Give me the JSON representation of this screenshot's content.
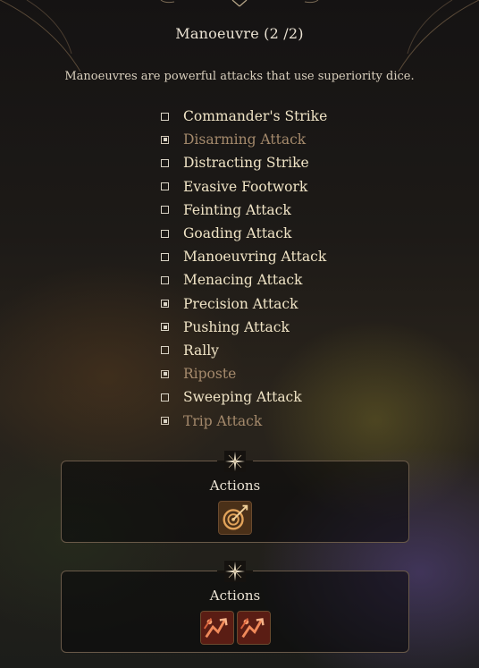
{
  "header": {
    "title": "Manoeuvre  (2 /2)",
    "description": "Manoeuvres are powerful attacks that use superiority dice."
  },
  "manoeuvres": [
    {
      "label": "Commander's Strike",
      "checked": false,
      "selected": false
    },
    {
      "label": "Disarming Attack",
      "checked": true,
      "selected": true
    },
    {
      "label": "Distracting Strike",
      "checked": false,
      "selected": false
    },
    {
      "label": "Evasive Footwork",
      "checked": false,
      "selected": false
    },
    {
      "label": "Feinting Attack",
      "checked": false,
      "selected": false
    },
    {
      "label": "Goading Attack",
      "checked": false,
      "selected": false
    },
    {
      "label": "Manoeuvring Attack",
      "checked": false,
      "selected": false
    },
    {
      "label": "Menacing Attack",
      "checked": false,
      "selected": false
    },
    {
      "label": "Precision Attack",
      "checked": true,
      "selected": false
    },
    {
      "label": "Pushing Attack",
      "checked": true,
      "selected": false
    },
    {
      "label": "Rally",
      "checked": false,
      "selected": false
    },
    {
      "label": "Riposte",
      "checked": true,
      "selected": true
    },
    {
      "label": "Sweeping Attack",
      "checked": false,
      "selected": false
    },
    {
      "label": "Trip Attack",
      "checked": true,
      "selected": true
    }
  ],
  "panels": [
    {
      "label": "Actions",
      "icons": [
        "precision-attack-icon"
      ]
    },
    {
      "label": "Actions",
      "icons": [
        "pushing-attack-icon",
        "pushing-attack-icon"
      ]
    }
  ],
  "colors": {
    "text_primary": "#f0e4c6",
    "text_selected": "#a58a6c",
    "panel_border": "#6a5a49"
  }
}
